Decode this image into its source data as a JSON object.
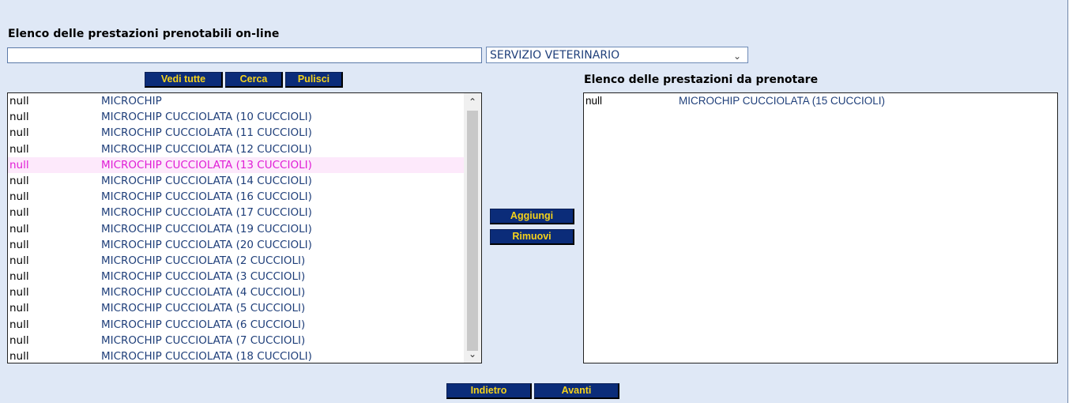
{
  "page_title": "Elenco delle prestazioni prenotabili on-line",
  "search": {
    "value": ""
  },
  "category_select": {
    "selected": "SERVIZIO VETERINARIO"
  },
  "buttons": {
    "vedi_tutte": "Vedi tutte",
    "cerca": "Cerca",
    "pulisci": "Pulisci",
    "aggiungi": "Aggiungi",
    "rimuovi": "Rimuovi",
    "indietro": "Indietro",
    "avanti": "Avanti"
  },
  "right_title": "Elenco delle prestazioni da prenotare",
  "available_list": [
    {
      "code": "null",
      "name": "MICROCHIP"
    },
    {
      "code": "null",
      "name": "MICROCHIP CUCCIOLATA (10 CUCCIOLI)"
    },
    {
      "code": "null",
      "name": "MICROCHIP CUCCIOLATA (11 CUCCIOLI)"
    },
    {
      "code": "null",
      "name": "MICROCHIP CUCCIOLATA (12 CUCCIOLI)"
    },
    {
      "code": "null",
      "name": "MICROCHIP CUCCIOLATA (13 CUCCIOLI)",
      "selected": true
    },
    {
      "code": "null",
      "name": "MICROCHIP CUCCIOLATA (14 CUCCIOLI)"
    },
    {
      "code": "null",
      "name": "MICROCHIP CUCCIOLATA (16 CUCCIOLI)"
    },
    {
      "code": "null",
      "name": "MICROCHIP CUCCIOLATA (17 CUCCIOLI)"
    },
    {
      "code": "null",
      "name": "MICROCHIP CUCCIOLATA (19 CUCCIOLI)"
    },
    {
      "code": "null",
      "name": "MICROCHIP CUCCIOLATA (20 CUCCIOLI)"
    },
    {
      "code": "null",
      "name": "MICROCHIP CUCCIOLATA (2 CUCCIOLI)"
    },
    {
      "code": "null",
      "name": "MICROCHIP CUCCIOLATA (3 CUCCIOLI)"
    },
    {
      "code": "null",
      "name": "MICROCHIP CUCCIOLATA (4 CUCCIOLI)"
    },
    {
      "code": "null",
      "name": "MICROCHIP CUCCIOLATA (5 CUCCIOLI)"
    },
    {
      "code": "null",
      "name": "MICROCHIP CUCCIOLATA (6 CUCCIOLI)"
    },
    {
      "code": "null",
      "name": "MICROCHIP CUCCIOLATA (7 CUCCIOLI)"
    },
    {
      "code": "null",
      "name": "MICROCHIP CUCCIOLATA (18 CUCCIOLI)"
    }
  ],
  "selected_list": [
    {
      "code": "null",
      "name": "MICROCHIP CUCCIOLATA (15 CUCCIOLI)"
    }
  ],
  "icons": {
    "scroll_up": "▲",
    "scroll_down": "▼",
    "select_chevron": "⌄"
  },
  "colors": {
    "panel_bg": "#dfe8f6",
    "button_bg": "#0b2c79",
    "button_text": "#f5d21a",
    "item_text": "#1f3f7a",
    "selected_text": "#e01ed6",
    "selected_bg": "#fde9fb"
  }
}
